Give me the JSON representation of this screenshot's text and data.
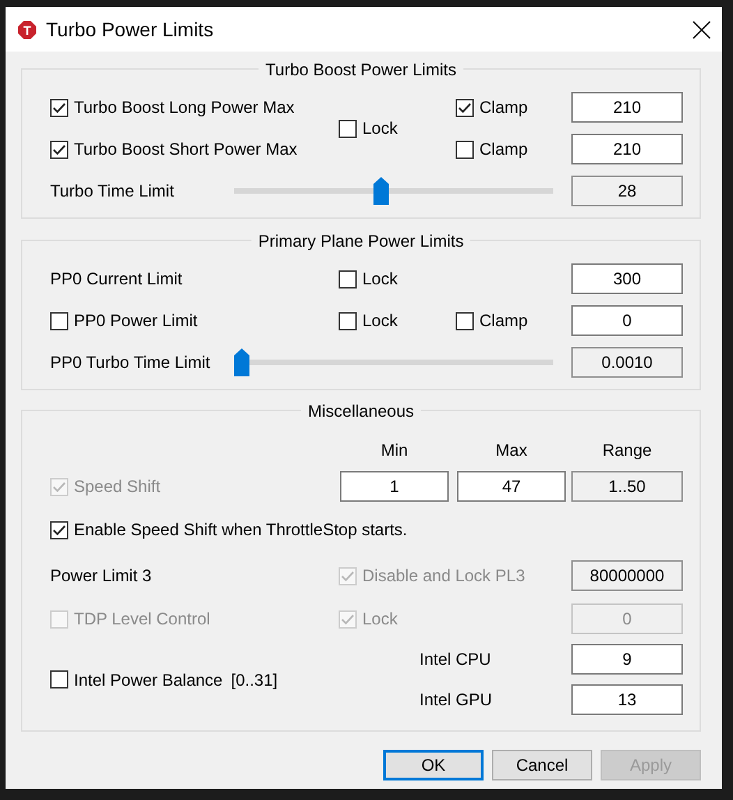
{
  "window": {
    "title": "Turbo Power Limits",
    "icon_letter": "T"
  },
  "turbo_boost": {
    "title": "Turbo Boost Power Limits",
    "long_power": {
      "label": "Turbo Boost Long Power Max",
      "checked": true
    },
    "short_power": {
      "label": "Turbo Boost Short Power Max",
      "checked": true
    },
    "lock": {
      "label": "Lock",
      "checked": false
    },
    "long_clamp": {
      "label": "Clamp",
      "checked": true
    },
    "short_clamp": {
      "label": "Clamp",
      "checked": false
    },
    "long_value": {
      "value": "210",
      "readonly": false
    },
    "short_value": {
      "value": "210",
      "readonly": false
    },
    "time_limit": {
      "label": "Turbo Time Limit",
      "level": 0.46,
      "reading": {
        "value": "28",
        "readonly": true
      }
    }
  },
  "primary_plane": {
    "title": "Primary Plane Power Limits",
    "current_limit": {
      "label": "PP0 Current Limit"
    },
    "current_lock": {
      "label": "Lock",
      "checked": false
    },
    "current_value": {
      "value": "300",
      "readonly": false
    },
    "power_limit": {
      "label": "PP0 Power Limit",
      "checked": false
    },
    "power_lock": {
      "label": "Lock",
      "checked": false
    },
    "power_clamp": {
      "label": "Clamp",
      "checked": false
    },
    "power_value": {
      "value": "0",
      "readonly": false
    },
    "time_limit": {
      "label": "PP0 Turbo Time Limit",
      "level": 0.0,
      "reading": {
        "value": "0.0010",
        "readonly": true
      }
    }
  },
  "misc": {
    "title": "Miscellaneous",
    "columns": [
      "Min",
      "Max",
      "Range"
    ],
    "speed_shift": {
      "label": "Speed Shift",
      "checked": true,
      "disabled": true
    },
    "min": {
      "value": "1",
      "readonly": false
    },
    "max": {
      "value": "47",
      "readonly": false
    },
    "range": {
      "value": "1..50",
      "readonly": true
    },
    "enable_speed_shift": {
      "label": "Enable Speed Shift when ThrottleStop starts.",
      "checked": true,
      "disabled": false
    },
    "power_limit_3": {
      "label": "Power Limit 3"
    },
    "disable_lock_pl3": {
      "label": "Disable and Lock PL3",
      "checked": true,
      "disabled": true
    },
    "pl3_value": {
      "value": "80000000",
      "readonly": true
    },
    "tdp_level_control": {
      "label": "TDP Level Control",
      "checked": false,
      "disabled": true
    },
    "tdp_lock": {
      "label": "Lock",
      "checked": true,
      "disabled": true
    },
    "tdp_value": {
      "value": "0",
      "readonly": true,
      "disabled": true
    },
    "intel_power_balance": {
      "label": "Intel Power Balance",
      "range": "[0..31]",
      "checked": false,
      "disabled": false
    },
    "intel_cpu": {
      "label": "Intel CPU",
      "value": {
        "value": "9",
        "readonly": false
      }
    },
    "intel_gpu": {
      "label": "Intel GPU",
      "value": {
        "value": "13",
        "readonly": false
      }
    }
  },
  "buttons": [
    {
      "label": "OK",
      "default": true,
      "disabled": false
    },
    {
      "label": "Cancel",
      "default": false,
      "disabled": false
    },
    {
      "label": "Apply",
      "default": false,
      "disabled": true
    }
  ]
}
